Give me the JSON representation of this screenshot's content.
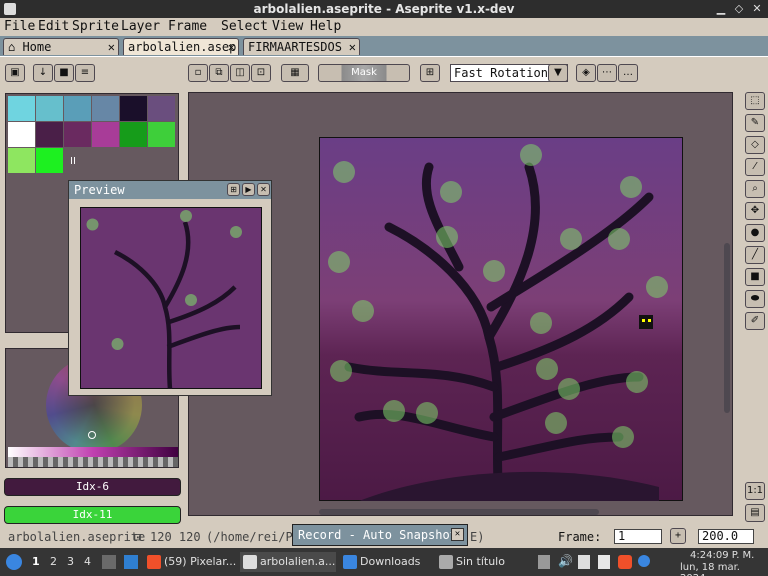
{
  "window": {
    "title": "arbolalien.aseprite - Aseprite v1.x-dev"
  },
  "menu": [
    "File",
    "Edit",
    "Sprite",
    "Layer",
    "Frame",
    "Select",
    "View",
    "Help"
  ],
  "tabs": [
    {
      "label": "Home"
    },
    {
      "label": "arbolalien.asepri"
    },
    {
      "label": "FIRMAARTESDOS"
    }
  ],
  "toolbar": {
    "mask_label": "Mask",
    "rotation_select": "Fast Rotation"
  },
  "palette": {
    "swatches": [
      "#6fd4e0",
      "#66bfcc",
      "#5a9eb8",
      "#6787a6",
      "#1a0f2a",
      "#6a4e7e",
      "#ffffff",
      "#4a1f48",
      "#6a2a60",
      "#a83c98",
      "#169c1a",
      "#3ecf3a",
      "#8ee660",
      "#1df020"
    ],
    "more_label": "II"
  },
  "preview": {
    "title": "Preview"
  },
  "color_buttons": {
    "fg_label": "Idx-6",
    "bg_label": "Idx-11"
  },
  "status": {
    "filename": "arbolalien.aseprite",
    "size": "120 120",
    "path": "(/home/rei/P",
    "path_end": "E)",
    "frame_label": "Frame:",
    "frame_value": "1",
    "zoom_value": "200.0"
  },
  "record_popup": {
    "label": "Record - Auto Snapshot"
  },
  "taskbar": {
    "workspaces": [
      "1",
      "2",
      "3",
      "4"
    ],
    "tasks": [
      {
        "label": "(59) Pixelar..."
      },
      {
        "label": "arbolalien.a..."
      },
      {
        "label": "Downloads"
      },
      {
        "label": "Sin título"
      }
    ],
    "time": "4:24:09 P. M.",
    "date": "lun, 18 mar. 2024"
  },
  "colors": {
    "accent_fg": "#421a3e",
    "accent_bg": "#3ad43a",
    "canvas_bg": "#66595f"
  }
}
